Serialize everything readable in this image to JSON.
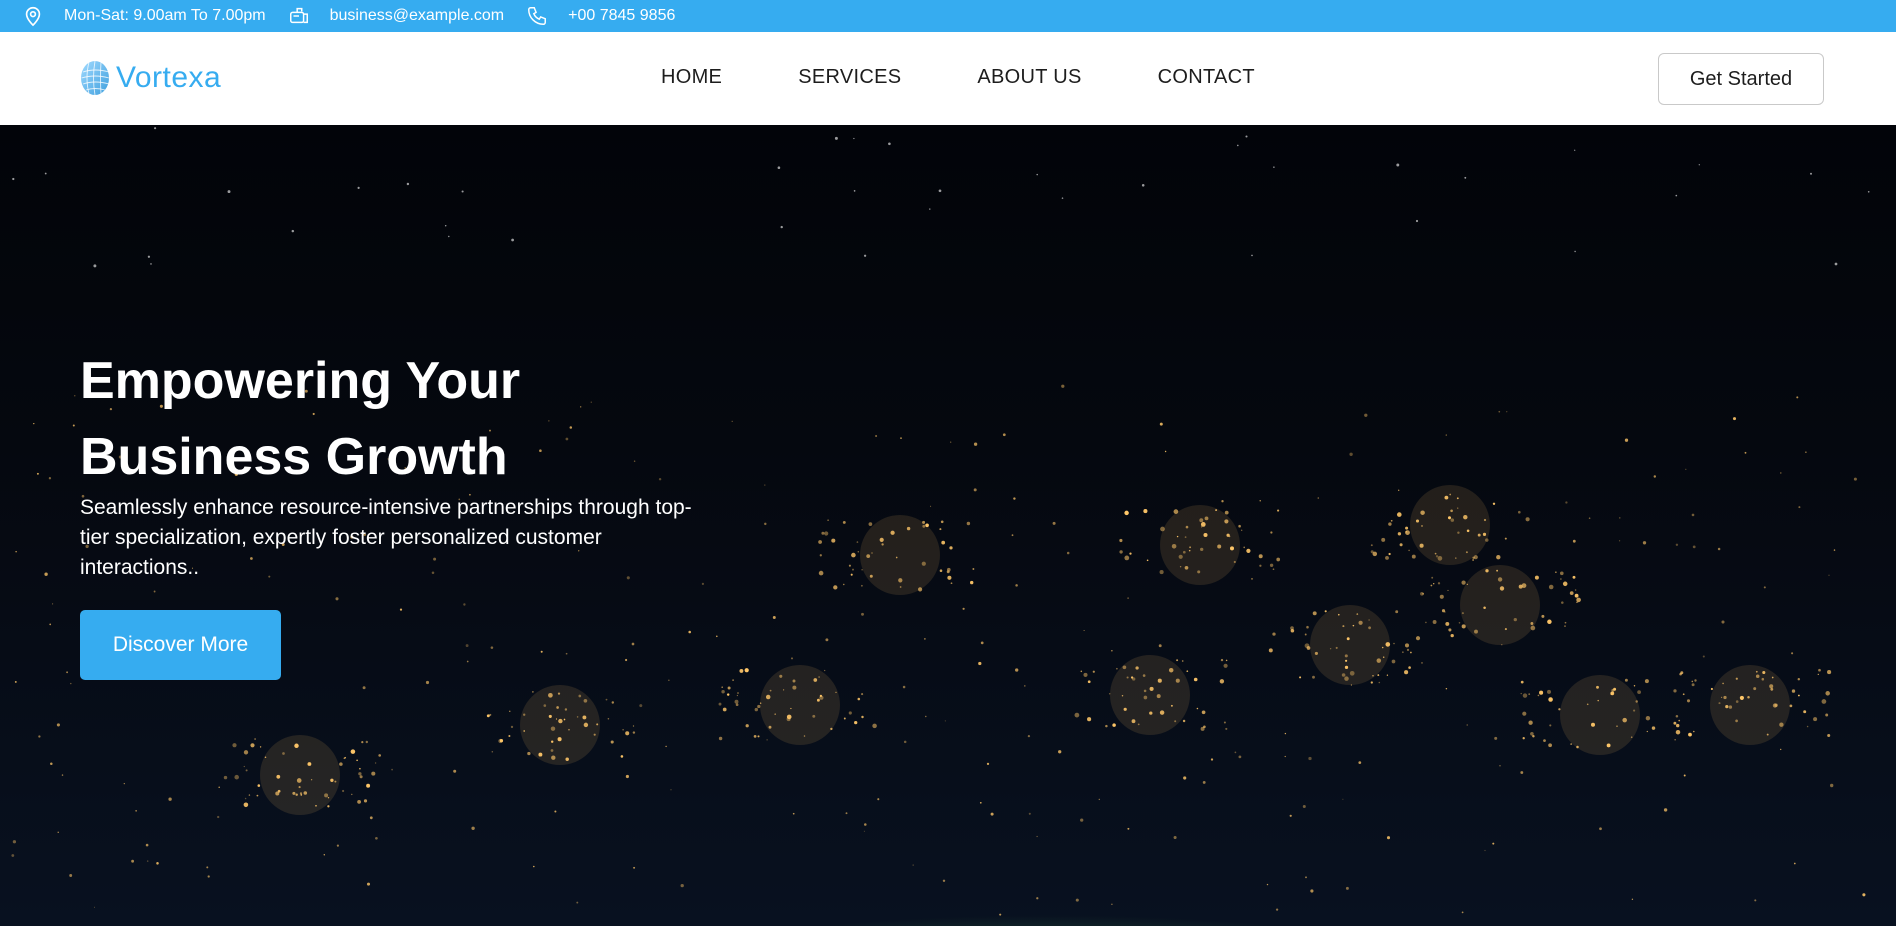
{
  "topbar": {
    "hours": "Mon-Sat: 9.00am To 7.00pm",
    "email": "business@example.com",
    "phone": "+00 7845 9856",
    "icons": [
      "location-pin-icon",
      "mailbox-icon",
      "phone-icon"
    ]
  },
  "header": {
    "logo_text": "Vortexa",
    "nav": [
      "HOME",
      "SERVICES",
      "ABOUT US",
      "CONTACT"
    ],
    "cta_label": "Get Started"
  },
  "hero": {
    "title_line1": "Empowering Your",
    "title_line2": "Business Growth",
    "subtitle": "Seamlessly enhance resource-intensive partnerships through top-tier specialization, expertly foster personalized customer interactions..",
    "button_label": "Discover More"
  },
  "colors": {
    "accent": "#36acf0",
    "header_bg": "#ffffff",
    "nav_text": "#1d1d1d"
  }
}
